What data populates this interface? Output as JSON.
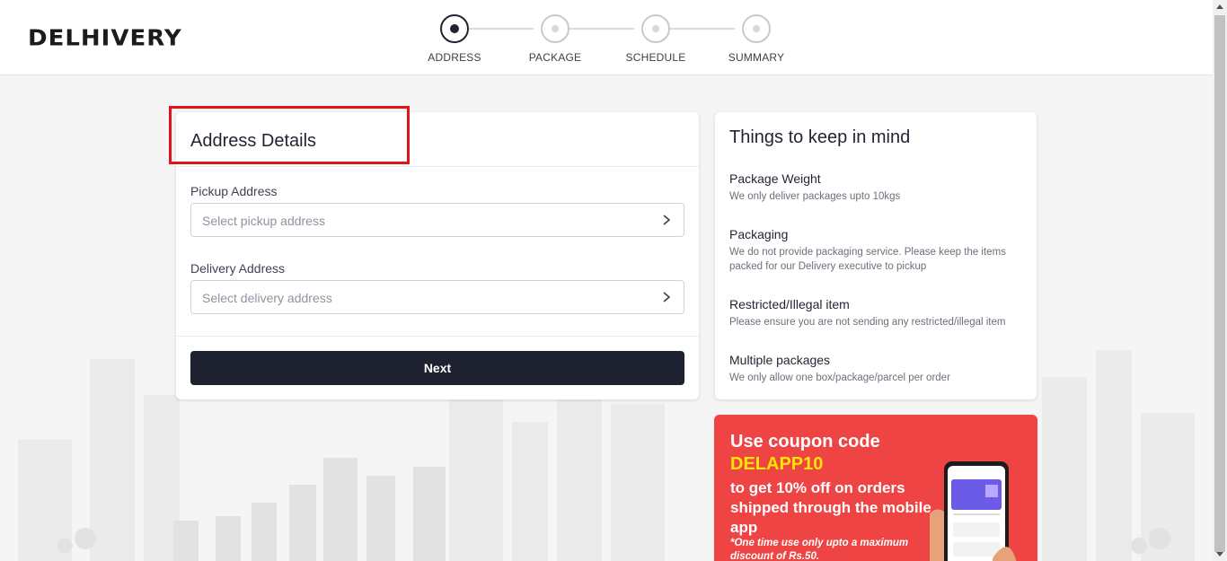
{
  "brand": {
    "logo_text": "DELHIVERY",
    "accent": "#ed1c24"
  },
  "stepper": {
    "steps": [
      {
        "label": "ADDRESS",
        "active": true
      },
      {
        "label": "PACKAGE",
        "active": false
      },
      {
        "label": "SCHEDULE",
        "active": false
      },
      {
        "label": "SUMMARY",
        "active": false
      }
    ]
  },
  "address_card": {
    "title": "Address Details",
    "pickup": {
      "label": "Pickup Address",
      "placeholder": "Select pickup address"
    },
    "delivery": {
      "label": "Delivery Address",
      "placeholder": "Select delivery address"
    },
    "next_label": "Next"
  },
  "tips": {
    "title": "Things to keep in mind",
    "items": [
      {
        "heading": "Package Weight",
        "desc": "We only deliver packages upto 10kgs"
      },
      {
        "heading": "Packaging",
        "desc": "We do not provide packaging service. Please keep the items packed for our Delivery executive to pickup"
      },
      {
        "heading": "Restricted/Illegal item",
        "desc": "Please ensure you are not sending any restricted/illegal item"
      },
      {
        "heading": "Multiple packages",
        "desc": "We only allow one box/package/parcel per order"
      }
    ]
  },
  "promo": {
    "line1": "Use coupon code",
    "code": "DELAPP10",
    "line3": "to get 10% off on orders shipped through the mobile app",
    "note": "*One time use only upto a maximum discount of Rs.50.",
    "bg_color": "#ee4444",
    "code_color": "#ffe600"
  }
}
